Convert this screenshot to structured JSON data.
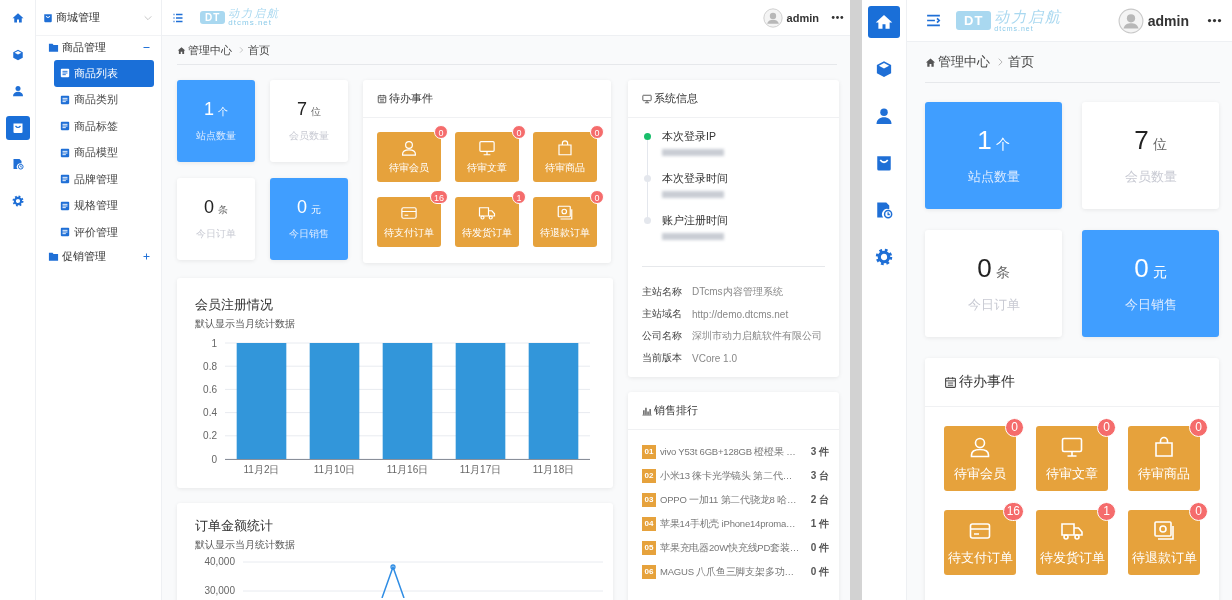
{
  "desktop": {
    "rail": [
      {
        "kind": "home",
        "selected": false
      },
      {
        "kind": "cube",
        "selected": false
      },
      {
        "kind": "user",
        "selected": false
      },
      {
        "kind": "bag",
        "selected": true
      },
      {
        "kind": "report",
        "selected": false
      },
      {
        "kind": "gear",
        "selected": false
      }
    ],
    "menu": {
      "title": "商城管理",
      "groups": [
        {
          "label": "商品管理",
          "expanded": true,
          "children": [
            {
              "label": "商品列表",
              "selected": true
            },
            {
              "label": "商品类别",
              "selected": false
            },
            {
              "label": "商品标签",
              "selected": false
            },
            {
              "label": "商品模型",
              "selected": false
            },
            {
              "label": "品牌管理",
              "selected": false
            },
            {
              "label": "规格管理",
              "selected": false
            },
            {
              "label": "评价管理",
              "selected": false
            }
          ]
        },
        {
          "label": "促销管理",
          "expanded": false
        }
      ]
    },
    "topbar": {
      "logo": {
        "mark": "DT",
        "name": "动力启航",
        "domain": "dtcms.net"
      },
      "user": "admin"
    },
    "breadcrumb": [
      "管理中心",
      "首页"
    ],
    "stats": [
      {
        "value": "1",
        "unit": "个",
        "label": "站点数量",
        "highlight": true
      },
      {
        "value": "7",
        "unit": "位",
        "label": "会员数量",
        "highlight": false
      },
      {
        "value": "0",
        "unit": "条",
        "label": "今日订单",
        "highlight": false
      },
      {
        "value": "0",
        "unit": "元",
        "label": "今日销售",
        "highlight": true
      }
    ],
    "todo": {
      "title": "待办事件",
      "items": [
        {
          "kind": "person",
          "label": "待审会员",
          "count": "0"
        },
        {
          "kind": "monitor",
          "label": "待审文章",
          "count": "0"
        },
        {
          "kind": "shop",
          "label": "待审商品",
          "count": "0"
        },
        {
          "kind": "card",
          "label": "待支付订单",
          "count": "16"
        },
        {
          "kind": "truck",
          "label": "待发货订单",
          "count": "1"
        },
        {
          "kind": "photo",
          "label": "待退款订单",
          "count": "0"
        }
      ]
    },
    "sysinfo": {
      "title": "系统信息",
      "timeline": [
        {
          "label": "本次登录IP",
          "active": true,
          "redacted": true
        },
        {
          "label": "本次登录时间",
          "active": false,
          "redacted": true
        },
        {
          "label": "账户注册时间",
          "active": false,
          "redacted": true
        }
      ],
      "fields": [
        {
          "label": "主站名称",
          "value": "DTcms内容管理系统"
        },
        {
          "label": "主站域名",
          "value": "http://demo.dtcms.net"
        },
        {
          "label": "公司名称",
          "value": "深圳市动力启航软件有限公司"
        },
        {
          "label": "当前版本",
          "value": "VCore 1.0"
        }
      ]
    },
    "ranking": {
      "title": "销售排行",
      "items": [
        {
          "rank": "01",
          "name": "vivo Y53t 6GB+128GB 橙橙果 …",
          "qty": "3 件"
        },
        {
          "rank": "02",
          "name": "小米13 徕卡光学镜头 第二代…",
          "qty": "3 台"
        },
        {
          "rank": "03",
          "name": "OPPO 一加11 第二代骁龙8 哈…",
          "qty": "2 台"
        },
        {
          "rank": "04",
          "name": "苹果14手机壳 iPhone14proma…",
          "qty": "1 件"
        },
        {
          "rank": "05",
          "name": "苹果充电器20W快充线PD套装…",
          "qty": "0 件"
        },
        {
          "rank": "06",
          "name": "MAGUS 八爪鱼三脚支架多功…",
          "qty": "0 件"
        }
      ]
    },
    "charts": [
      {
        "subtitle": "默认显示当月统计数据",
        "chart_data": {
          "type": "bar",
          "title": "会员注册情况",
          "categories": [
            "11月2日",
            "11月10日",
            "11月16日",
            "11月17日",
            "11月18日"
          ],
          "series": [
            {
              "color": "#3296da",
              "values": [
                1,
                1,
                1,
                1,
                1
              ]
            }
          ],
          "ylim": [
            0,
            1
          ],
          "yticks": [
            0,
            0.2,
            0.4,
            0.6,
            0.8,
            1
          ],
          "grid": true
        }
      },
      {
        "subtitle": "默认显示当月统计数据",
        "title": "订单金额统计",
        "y_labels": [
          "40,000",
          "30,000"
        ]
      }
    ]
  },
  "mobile": {
    "rail": [
      {
        "kind": "home",
        "selected": true
      },
      {
        "kind": "cube",
        "selected": false
      },
      {
        "kind": "user",
        "selected": false
      },
      {
        "kind": "bag",
        "selected": false
      },
      {
        "kind": "report",
        "selected": false
      },
      {
        "kind": "gear",
        "selected": false
      }
    ],
    "topbar": {
      "logo": {
        "mark": "DT",
        "name": "动力启航",
        "domain": "dtcms.net"
      },
      "user": "admin"
    },
    "breadcrumb": [
      "管理中心",
      "首页"
    ],
    "stats": [
      {
        "value": "1",
        "unit": "个",
        "label": "站点数量",
        "highlight": true
      },
      {
        "value": "7",
        "unit": "位",
        "label": "会员数量",
        "highlight": false
      },
      {
        "value": "0",
        "unit": "条",
        "label": "今日订单",
        "highlight": false
      },
      {
        "value": "0",
        "unit": "元",
        "label": "今日销售",
        "highlight": true
      }
    ],
    "todo": {
      "title": "待办事件",
      "items": [
        {
          "kind": "person",
          "label": "待审会员",
          "count": "0"
        },
        {
          "kind": "monitor",
          "label": "待审文章",
          "count": "0"
        },
        {
          "kind": "shop",
          "label": "待审商品",
          "count": "0"
        },
        {
          "kind": "card",
          "label": "待支付订单",
          "count": "16"
        },
        {
          "kind": "truck",
          "label": "待发货订单",
          "count": "1"
        },
        {
          "kind": "photo",
          "label": "待退款订单",
          "count": "0"
        }
      ]
    }
  }
}
